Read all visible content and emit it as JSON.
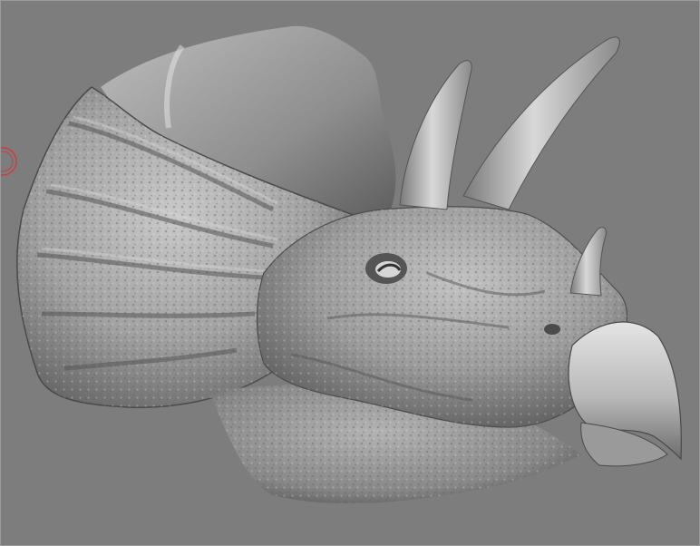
{
  "viewport": {
    "background_color": "#7d7d7d",
    "model": "triceratops-head-sculpt",
    "material_color": "#a8a8a8",
    "shadow_color": "#3a3a3a",
    "highlight_color": "#e6e6e6",
    "cursor_color": "#d23a3a"
  }
}
